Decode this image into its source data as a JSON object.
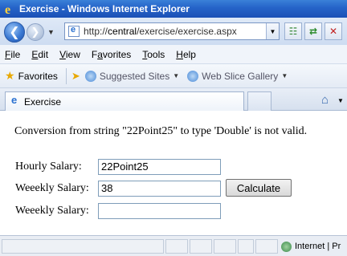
{
  "window": {
    "title": "Exercise - Windows Internet Explorer"
  },
  "address_bar": {
    "url_prefix": "http://",
    "url_host": "central",
    "url_path": "/exercise/exercise.aspx"
  },
  "menu": {
    "items": [
      {
        "accel": "F",
        "rest": "ile"
      },
      {
        "accel": "E",
        "rest": "dit"
      },
      {
        "accel": "V",
        "rest": "iew"
      },
      {
        "accel": "",
        "pre": "F",
        "accel2": "a",
        "rest": "vorites"
      },
      {
        "accel": "T",
        "rest": "ools"
      },
      {
        "accel": "H",
        "rest": "elp"
      }
    ]
  },
  "favorites_bar": {
    "favorites_label": "Favorites",
    "suggested_sites": "Suggested Sites",
    "web_slice_gallery": "Web Slice Gallery"
  },
  "tabs": {
    "active_tab_label": "Exercise"
  },
  "page": {
    "error_message": "Conversion from string \"22Point25\" to type 'Double' is not valid.",
    "hourly_salary_label": "Hourly Salary:",
    "hourly_salary_value": "22Point25",
    "weekly_salary_label_1": "Weeekly Salary:",
    "weekly_salary_value_1": "38",
    "weekly_salary_label_2": "Weeekly Salary:",
    "weekly_salary_value_2": "",
    "calculate_button": "Calculate"
  },
  "status_bar": {
    "zone_text": "Internet | Pr"
  },
  "icons": {
    "back": "back-arrow-icon",
    "forward": "forward-arrow-icon",
    "refresh": "refresh-icon",
    "stop": "stop-icon",
    "home": "home-icon",
    "favorites": "star-icon"
  }
}
